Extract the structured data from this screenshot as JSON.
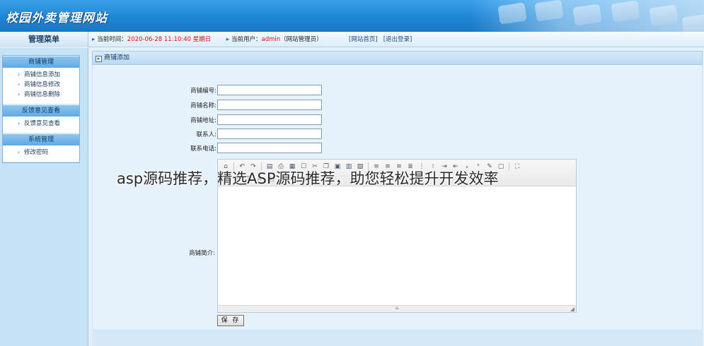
{
  "header": {
    "logo_text": "校园外卖管理网站"
  },
  "topbar": {
    "menu_title": "管理菜单",
    "time_label": "当前时间：",
    "time_value": "2020-06-28 11:10:40 星期日",
    "user_label": "当前用户：",
    "user_value": "admin",
    "user_role": "（网站管理员）",
    "link_home": "[网站首页]",
    "link_logout": "[退出登录]"
  },
  "sidebar": {
    "groups": [
      {
        "title": "商铺管理",
        "items": [
          "商铺信息添加",
          "商铺信息修改",
          "商铺信息删除"
        ]
      },
      {
        "title": "反馈意见查看",
        "items": [
          "反馈意见查看"
        ]
      },
      {
        "title": "系统管理",
        "items": [
          "修改密码"
        ]
      }
    ]
  },
  "main": {
    "panel_title": "商铺添加",
    "fields": [
      {
        "label": "商铺编号:",
        "value": ""
      },
      {
        "label": "商铺名称:",
        "value": ""
      },
      {
        "label": "商铺地址:",
        "value": ""
      },
      {
        "label": "联系人:",
        "value": ""
      },
      {
        "label": "联系电话:",
        "value": ""
      }
    ],
    "intro_label": "商铺简介:",
    "save_label": "保 存"
  },
  "watermark": "asp源码推荐，精选ASP源码推荐，助您轻松提升开发效率",
  "colors": {
    "header_blue": "#1f86d6",
    "sidebar_title": "#5fa9e3",
    "time_red": "#d01010"
  }
}
